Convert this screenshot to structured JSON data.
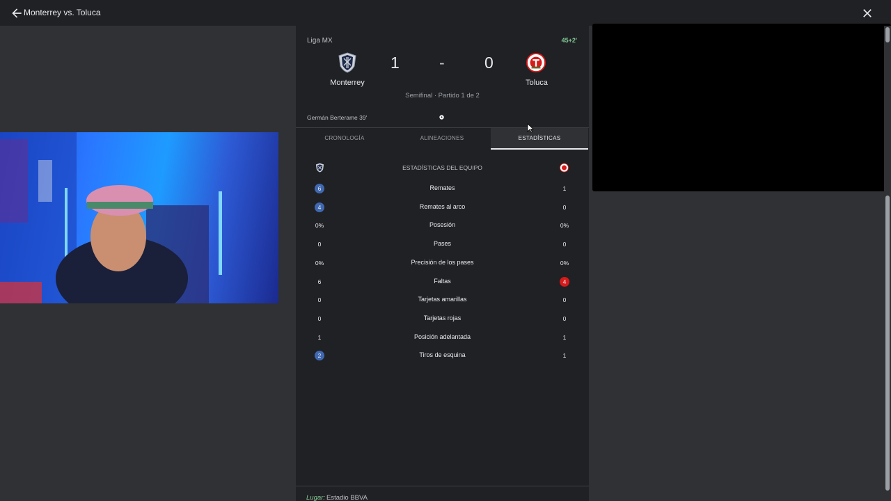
{
  "header": {
    "title": "Monterrey vs. Toluca",
    "back_icon": "arrow-left-icon",
    "close_icon": "close-icon"
  },
  "match": {
    "league": "Liga MX",
    "live_time": "45+2'",
    "home_team": "Monterrey",
    "away_team": "Toluca",
    "home_score": "1",
    "separator": "-",
    "away_score": "0",
    "info": "Semifinal · Partido 1 de 2",
    "scorer": "Germán Berterame 39'"
  },
  "tabs": [
    {
      "label": "CRONOLOGÍA",
      "active": false
    },
    {
      "label": "ALINEACIONES",
      "active": false
    },
    {
      "label": "ESTADÍSTICAS",
      "active": true
    }
  ],
  "stats": {
    "header": "ESTADÍSTICAS DEL EQUIPO",
    "rows": [
      {
        "label": "Remates",
        "home": "6",
        "away": "1",
        "leader": "home"
      },
      {
        "label": "Remates al arco",
        "home": "4",
        "away": "0",
        "leader": "home"
      },
      {
        "label": "Posesión",
        "home": "0%",
        "away": "0%",
        "leader": "none"
      },
      {
        "label": "Pases",
        "home": "0",
        "away": "0",
        "leader": "none"
      },
      {
        "label": "Precisión de los pases",
        "home": "0%",
        "away": "0%",
        "leader": "none"
      },
      {
        "label": "Faltas",
        "home": "6",
        "away": "4",
        "leader": "away"
      },
      {
        "label": "Tarjetas amarillas",
        "home": "0",
        "away": "0",
        "leader": "none"
      },
      {
        "label": "Tarjetas rojas",
        "home": "0",
        "away": "0",
        "leader": "none"
      },
      {
        "label": "Posición adelantada",
        "home": "1",
        "away": "1",
        "leader": "none"
      },
      {
        "label": "Tiros de esquina",
        "home": "2",
        "away": "1",
        "leader": "home"
      }
    ]
  },
  "venue": {
    "label": "Lugar:",
    "value": "Estadio BBVA"
  },
  "colors": {
    "home_accent": "#3f68b0",
    "away_accent": "#d71a1a",
    "live": "#81c995"
  }
}
